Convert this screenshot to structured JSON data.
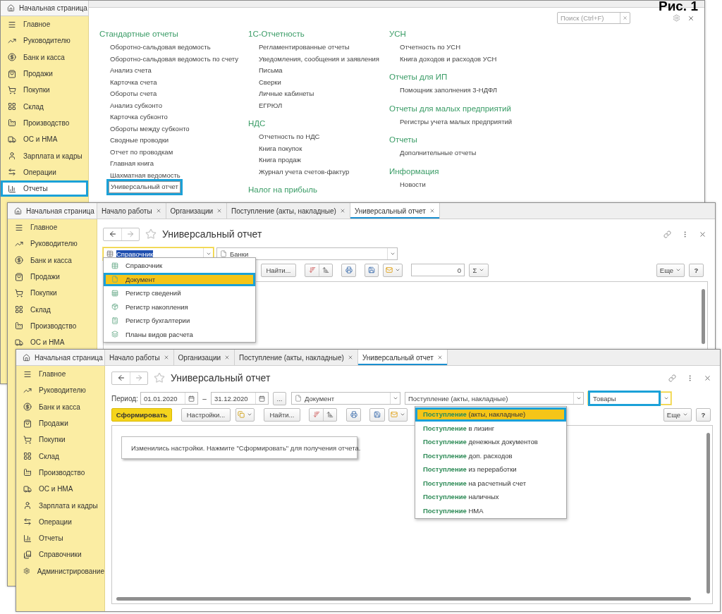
{
  "figure_label": "Рис. 1",
  "reports_window": {
    "home_tab": "Начальная страница",
    "sidebar": [
      {
        "label": "Главное",
        "selected": false
      },
      {
        "label": "Руководителю",
        "selected": false
      },
      {
        "label": "Банк и касса",
        "selected": false
      },
      {
        "label": "Продажи",
        "selected": false
      },
      {
        "label": "Покупки",
        "selected": false
      },
      {
        "label": "Склад",
        "selected": false
      },
      {
        "label": "Производство",
        "selected": false
      },
      {
        "label": "ОС и НМА",
        "selected": false
      },
      {
        "label": "Зарплата и кадры",
        "selected": false
      },
      {
        "label": "Операции",
        "selected": false
      },
      {
        "label": "Отчеты",
        "selected": true
      }
    ],
    "search": {
      "placeholder": "Поиск (Ctrl+F)"
    },
    "columns": [
      {
        "sections": [
          {
            "title": "Стандартные отчеты",
            "items": [
              {
                "label": "Оборотно-сальдовая ведомость",
                "highlighted": false
              },
              {
                "label": "Оборотно-сальдовая ведомость по счету",
                "highlighted": false
              },
              {
                "label": "Анализ счета",
                "highlighted": false
              },
              {
                "label": "Карточка счета",
                "highlighted": false
              },
              {
                "label": "Обороты счета",
                "highlighted": false
              },
              {
                "label": "Анализ субконто",
                "highlighted": false
              },
              {
                "label": "Карточка субконто",
                "highlighted": false
              },
              {
                "label": "Обороты между субконто",
                "highlighted": false
              },
              {
                "label": "Сводные проводки",
                "highlighted": false
              },
              {
                "label": "Отчет по проводкам",
                "highlighted": false
              },
              {
                "label": "Главная книга",
                "highlighted": false
              },
              {
                "label": "Шахматная ведомость",
                "highlighted": false
              },
              {
                "label": "Универсальный отчет",
                "highlighted": true
              }
            ]
          }
        ]
      },
      {
        "sections": [
          {
            "title": "1С-Отчетность",
            "items": [
              {
                "label": "Регламентированные отчеты",
                "highlighted": false
              },
              {
                "label": "Уведомления, сообщения и заявления",
                "highlighted": false
              },
              {
                "label": "Письма",
                "highlighted": false
              },
              {
                "label": "Сверки",
                "highlighted": false
              },
              {
                "label": "Личные кабинеты",
                "highlighted": false
              },
              {
                "label": "ЕГРЮЛ",
                "highlighted": false
              }
            ]
          },
          {
            "title": "НДС",
            "items": [
              {
                "label": "Отчетность по НДС",
                "highlighted": false
              },
              {
                "label": "Книга покупок",
                "highlighted": false
              },
              {
                "label": "Книга продаж",
                "highlighted": false
              },
              {
                "label": "Журнал учета счетов-фактур",
                "highlighted": false
              }
            ]
          },
          {
            "title": "Налог на прибыль"
          }
        ]
      },
      {
        "sections": [
          {
            "title": "УСН",
            "items": [
              {
                "label": "Отчетность по УСН",
                "highlighted": false
              },
              {
                "label": "Книга доходов и расходов УСН",
                "highlighted": false
              }
            ]
          },
          {
            "title": "Отчеты для ИП",
            "items": [
              {
                "label": "Помощник заполнения 3-НДФЛ",
                "highlighted": false
              }
            ]
          },
          {
            "title": "Отчеты для малых предприятий",
            "items": [
              {
                "label": "Регистры учета малых предприятий",
                "highlighted": false
              }
            ]
          },
          {
            "title": "Отчеты",
            "items": [
              {
                "label": "Дополнительные отчеты",
                "highlighted": false
              }
            ]
          },
          {
            "title": "Информация",
            "items": [
              {
                "label": "Новости",
                "highlighted": false
              }
            ]
          }
        ]
      }
    ]
  },
  "query_window": {
    "home_tab": "Начальная страница",
    "tabs": [
      {
        "label": "Начало работы",
        "selected": false
      },
      {
        "label": "Организации",
        "selected": false
      },
      {
        "label": "Поступление (акты, накладные)",
        "selected": false
      },
      {
        "label": "Универсальный отчет",
        "selected": true
      }
    ],
    "sidebar": [
      {
        "label": "Главное",
        "selected": false
      },
      {
        "label": "Руководителю",
        "selected": false
      },
      {
        "label": "Банк и касса",
        "selected": false
      },
      {
        "label": "Продажи",
        "selected": false
      },
      {
        "label": "Покупки",
        "selected": false
      },
      {
        "label": "Склад",
        "selected": false
      },
      {
        "label": "Производство",
        "selected": false
      },
      {
        "label": "ОС и НМА",
        "selected": false
      }
    ],
    "title": "Универсальный отчет",
    "type_field": {
      "value": "Справочник",
      "focused": true
    },
    "object_field": {
      "value": "Банки"
    },
    "find_button": "Найти...",
    "counter_value": "0",
    "sum_button": "Σ",
    "more_button": "Еще",
    "help_button": "?",
    "type_options": [
      {
        "label": "Справочник",
        "selected": false,
        "highlighted": false
      },
      {
        "label": "Документ",
        "selected": true,
        "highlighted": true
      },
      {
        "label": "Регистр сведений",
        "selected": false,
        "highlighted": false
      },
      {
        "label": "Регистр накопления",
        "selected": false,
        "highlighted": false
      },
      {
        "label": "Регистр бухгалтерии",
        "selected": false,
        "highlighted": false
      },
      {
        "label": "Планы видов расчета",
        "selected": false,
        "highlighted": false
      }
    ]
  },
  "result_window": {
    "home_tab": "Начальная страница",
    "tabs": [
      {
        "label": "Начало работы",
        "selected": false
      },
      {
        "label": "Организации",
        "selected": false
      },
      {
        "label": "Поступление (акты, накладные)",
        "selected": false
      },
      {
        "label": "Универсальный отчет",
        "selected": true
      }
    ],
    "sidebar": [
      {
        "label": "Главное",
        "selected": false
      },
      {
        "label": "Руководителю",
        "selected": false
      },
      {
        "label": "Банк и касса",
        "selected": false
      },
      {
        "label": "Продажи",
        "selected": false
      },
      {
        "label": "Покупки",
        "selected": false
      },
      {
        "label": "Склад",
        "selected": false
      },
      {
        "label": "Производство",
        "selected": false
      },
      {
        "label": "ОС и НМА",
        "selected": false
      },
      {
        "label": "Зарплата и кадры",
        "selected": false
      },
      {
        "label": "Операции",
        "selected": false
      },
      {
        "label": "Отчеты",
        "selected": false
      },
      {
        "label": "Справочники",
        "selected": false
      },
      {
        "label": "Администрирование",
        "selected": false
      }
    ],
    "title": "Универсальный отчет",
    "period_label": "Период:",
    "date_from": "01.01.2020",
    "date_separator": "–",
    "date_to": "31.12.2020",
    "period_button": "...",
    "type_field": {
      "value": "Документ"
    },
    "object_field": {
      "value": "Поступление (акты, накладные)"
    },
    "table_field": {
      "value": "Товары",
      "highlighted": true
    },
    "generate_button": "Сформировать",
    "settings_button": "Настройки...",
    "find_button": "Найти...",
    "more_button": "Еще",
    "help_button": "?",
    "message": "Изменились настройки. Нажмите \"Сформировать\" для получения отчета.",
    "object_options": [
      {
        "label": "**Поступление** (акты, накладные)",
        "selected": true,
        "highlighted": true
      },
      {
        "label": "**Поступление** в лизинг",
        "selected": false,
        "highlighted": false
      },
      {
        "label": "**Поступление** денежных документов",
        "selected": false,
        "highlighted": false
      },
      {
        "label": "**Поступление** доп. расходов",
        "selected": false,
        "highlighted": false
      },
      {
        "label": "**Поступление** из переработки",
        "selected": false,
        "highlighted": false
      },
      {
        "label": "**Поступление** на расчетный счет",
        "selected": false,
        "highlighted": false
      },
      {
        "label": "**Поступление** наличных",
        "selected": false,
        "highlighted": false
      },
      {
        "label": "**Поступление** НМА",
        "selected": false,
        "highlighted": false
      }
    ]
  }
}
